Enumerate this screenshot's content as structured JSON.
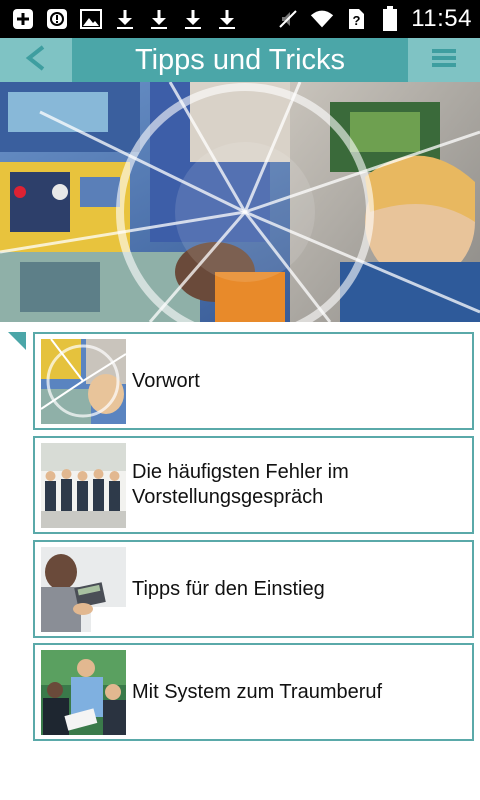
{
  "status_bar": {
    "time": "11:54",
    "notifications": [
      "add-box-icon",
      "info-icon",
      "image-icon",
      "download-icon",
      "download-icon",
      "download-icon",
      "download-icon"
    ],
    "system": [
      "mute-icon",
      "wifi-icon",
      "no-sim-icon",
      "battery-icon"
    ]
  },
  "appbar": {
    "title": "Tipps und Tricks",
    "back_icon": "back-chevron-icon",
    "menu_icon": "menu-icon"
  },
  "colors": {
    "accent": "#4ba6a8",
    "accent_light": "#7fc3c4",
    "border": "#5aa9a9"
  },
  "list": {
    "items": [
      {
        "label": "Vorwort",
        "thumb": "industrial-collage-thumbnail"
      },
      {
        "label": "Die häufigsten Fehler im Vorstellungsgespräch",
        "thumb": "waiting-applicants-thumbnail"
      },
      {
        "label": "Tipps für den Einstieg",
        "thumb": "calculator-desk-thumbnail"
      },
      {
        "label": "Mit System zum Traumberuf",
        "thumb": "office-meeting-thumbnail"
      }
    ]
  }
}
